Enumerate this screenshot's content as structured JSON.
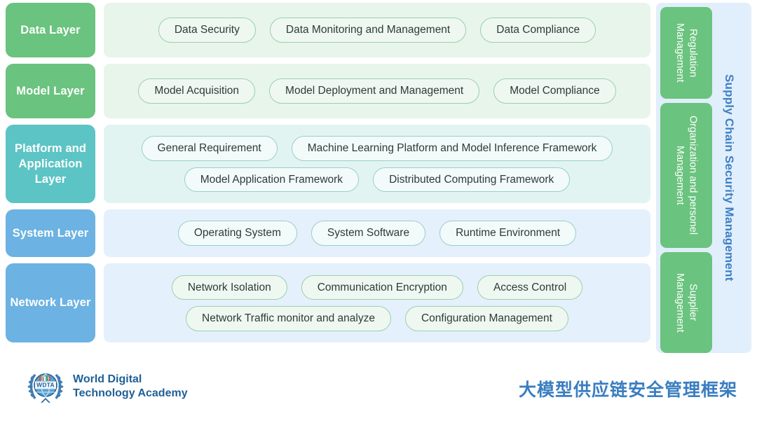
{
  "layers": [
    {
      "name": "Data Layer",
      "badge_color": "#6ac37e",
      "panel_color": "#e8f5ea",
      "pill_rows": [
        [
          "Data Security",
          "Data Monitoring and Management",
          "Data Compliance"
        ]
      ]
    },
    {
      "name": "Model Layer",
      "badge_color": "#6ac37e",
      "panel_color": "#e8f5ea",
      "pill_rows": [
        [
          "Model Acquisition",
          "Model Deployment  and Management",
          "Model Compliance"
        ]
      ]
    },
    {
      "name": "Platform and Application Layer",
      "badge_color": "#5cc4c4",
      "panel_color": "#e2f4f2",
      "pill_rows": [
        [
          "General Requirement",
          "Machine Learning Platform and Model Inference Framework"
        ],
        [
          "Model Application Framework",
          "Distributed Computing Framework"
        ]
      ]
    },
    {
      "name": "System Layer",
      "badge_color": "#6cb2e2",
      "panel_color": "#e4f0fb",
      "pill_rows": [
        [
          "Operating System",
          "System Software",
          "Runtime Environment"
        ]
      ]
    },
    {
      "name": "Network Layer",
      "badge_color": "#6cb2e2",
      "panel_color": "#e4f0fb",
      "pill_rows": [
        [
          "Network Isolation",
          "Communication Encryption",
          "Access Control"
        ],
        [
          "Network Traffic monitor and analyze",
          "Configuration Management"
        ]
      ]
    }
  ],
  "sidebar": {
    "title": "Supply Chain Security Management",
    "title_color": "#3f7fc4",
    "background": "#e1eefb",
    "boxes": [
      {
        "label": "Regulation Management"
      },
      {
        "label": "Organization and personel Management"
      },
      {
        "label": "Supplier Management"
      }
    ]
  },
  "footer": {
    "brand_line1": "World Digital",
    "brand_line2": "Technology Academy",
    "brand_color": "#1f5f96",
    "logo_text": "WDTA",
    "cn_title": "大模型供应链安全管理框架",
    "cn_title_color": "#3a7ec0"
  }
}
